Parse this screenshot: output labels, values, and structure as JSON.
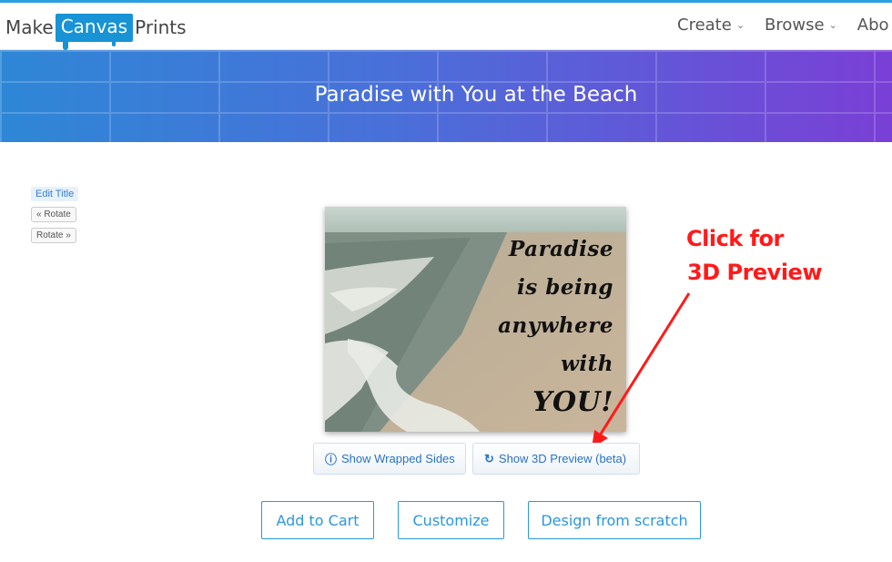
{
  "brand": {
    "part1": "Make",
    "part2": "Canvas",
    "part3": "Prints",
    "accent": "#1793d6"
  },
  "nav": {
    "items": [
      {
        "label": "Create"
      },
      {
        "label": "Browse"
      },
      {
        "label": "Abo"
      }
    ],
    "chevron": "⌄"
  },
  "banner": {
    "title": "Paradise with You at the Beach"
  },
  "sidebar": {
    "edit_title": "Edit Title",
    "rotate_left": "« Rotate",
    "rotate_right": "Rotate »"
  },
  "canvas": {
    "quote_lines": [
      "Paradise",
      "is being",
      "anywhere",
      "with"
    ],
    "quote_last": "YOU!"
  },
  "annotation": {
    "line1": "Click for",
    "line2": "3D Preview",
    "color": "#ff1a1a"
  },
  "preview_buttons": {
    "wrapped": "Show Wrapped Sides",
    "preview3d": "Show 3D Preview (beta)"
  },
  "actions": {
    "add_to_cart": "Add to Cart",
    "customize": "Customize",
    "design": "Design from scratch"
  }
}
